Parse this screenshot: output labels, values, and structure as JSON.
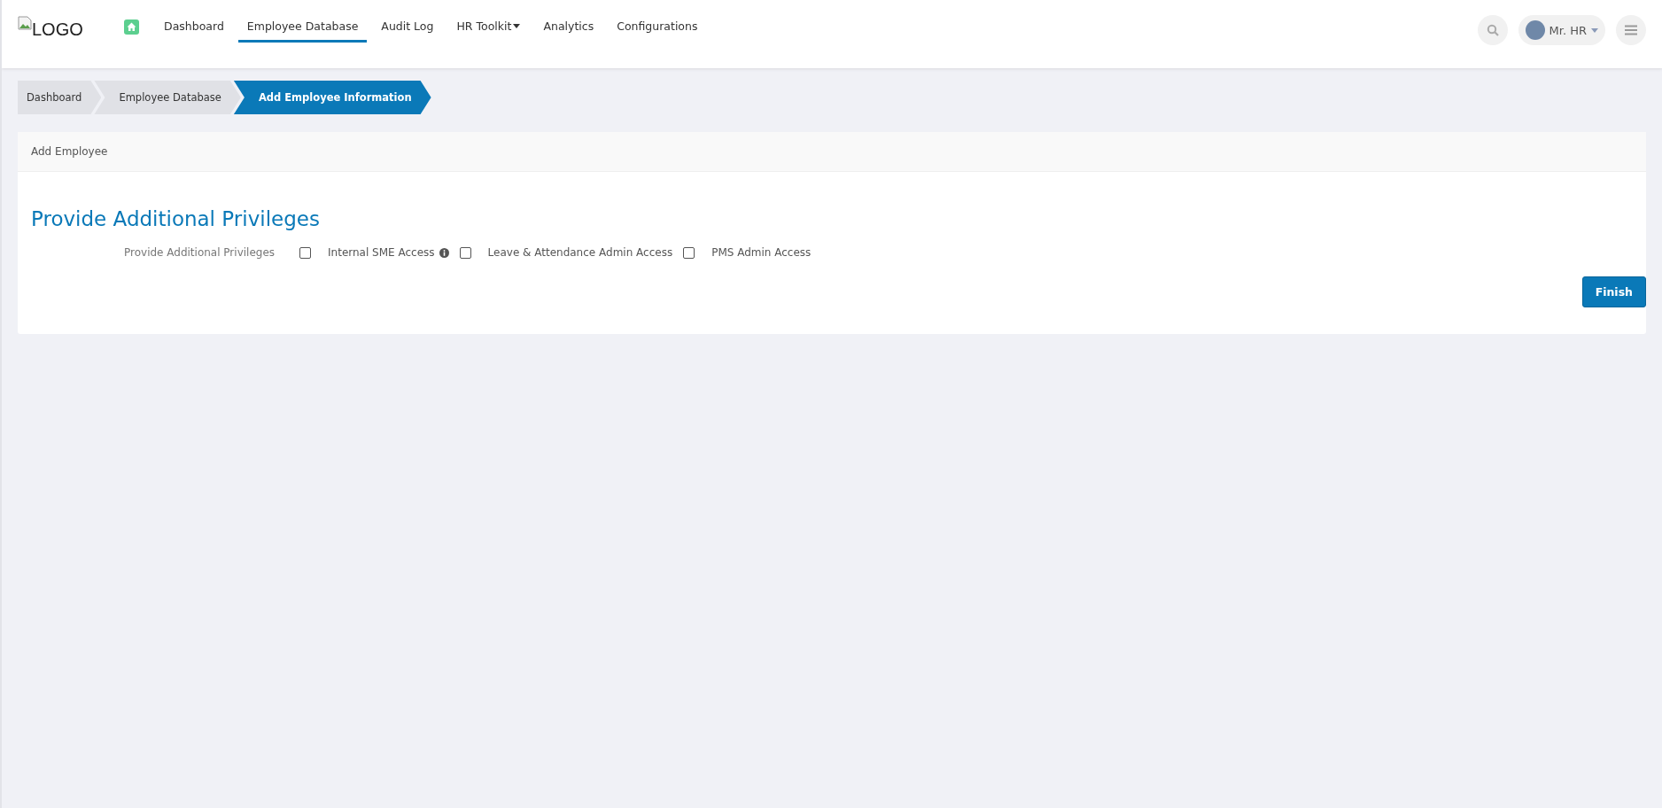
{
  "header": {
    "logo_alt": "LOGO",
    "nav": [
      {
        "label": "Dashboard",
        "selected": false,
        "dropdown": false
      },
      {
        "label": "Employee Database",
        "selected": true,
        "dropdown": false
      },
      {
        "label": "Audit Log",
        "selected": false,
        "dropdown": false
      },
      {
        "label": "HR Toolkit",
        "selected": false,
        "dropdown": true
      },
      {
        "label": "Analytics",
        "selected": false,
        "dropdown": false
      },
      {
        "label": "Configurations",
        "selected": false,
        "dropdown": false
      }
    ],
    "user": "Mr. HR"
  },
  "breadcrumbs": [
    {
      "label": "Dashboard",
      "selected": false
    },
    {
      "label": "Employee Database",
      "selected": false
    },
    {
      "label": "Add Employee Information",
      "selected": true
    }
  ],
  "card": {
    "title": "Add Employee",
    "section_title": "Provide Additional Privileges",
    "field_label": "Provide Additional Privileges",
    "options": [
      {
        "label": "Internal SME Access",
        "checked": false,
        "info": true
      },
      {
        "label": "Leave & Attendance Admin Access",
        "checked": false,
        "info": false
      },
      {
        "label": "PMS Admin Access",
        "checked": false,
        "info": false
      }
    ],
    "button": "Finish"
  }
}
